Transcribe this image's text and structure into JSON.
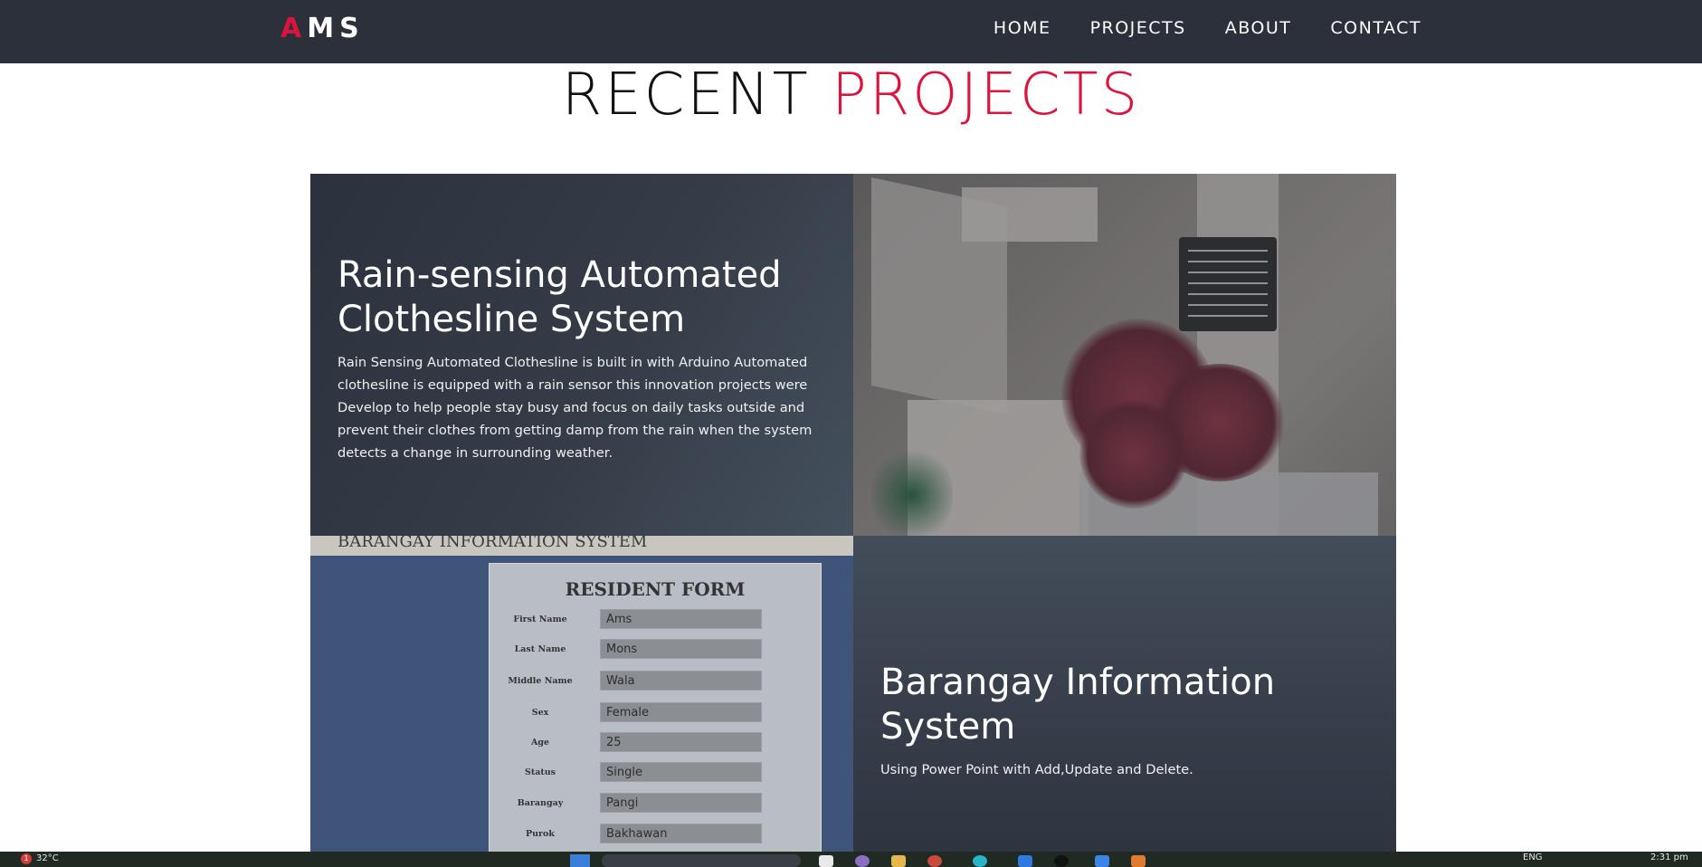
{
  "nav": {
    "logo": {
      "first": "A",
      "rest": "MS"
    },
    "links": [
      "HOME",
      "PROJECTS",
      "ABOUT",
      "CONTACT"
    ]
  },
  "heading": {
    "part1": "RECENT",
    "part2": "PROJECTS"
  },
  "projects": [
    {
      "title": "Rain-sensing Automated Clothesline System",
      "description": "Rain Sensing Automated Clothesline is built in with Arduino Automated clothesline is equipped with a rain sensor this innovation projects were Develop to help people stay busy and focus on daily tasks outside and prevent their clothes from getting damp from the rain when the system detects a change in surrounding weather."
    },
    {
      "title": "Barangay Information System",
      "description": "Using Power Point with Add,Update and Delete."
    }
  ],
  "form_image": {
    "header": "BARANGAY INFORMATION SYSTEM",
    "title": "RESIDENT FORM",
    "fields": [
      {
        "label": "First Name",
        "value": "Ams"
      },
      {
        "label": "Last Name",
        "value": "Mons"
      },
      {
        "label": "Middle Name",
        "value": "Wala"
      },
      {
        "label": "Sex",
        "value": "Female"
      },
      {
        "label": "Age",
        "value": "25"
      },
      {
        "label": "Status",
        "value": "Single"
      },
      {
        "label": "Barangay",
        "value": "Pangi"
      },
      {
        "label": "Purok",
        "value": "Bakhawan"
      }
    ]
  },
  "taskbar": {
    "weather": "32°C",
    "badge": "1",
    "lang": "ENG",
    "time": "2:31 pm"
  },
  "colors": {
    "accent": "#dc143c",
    "nav_bg": "#2b303b"
  }
}
